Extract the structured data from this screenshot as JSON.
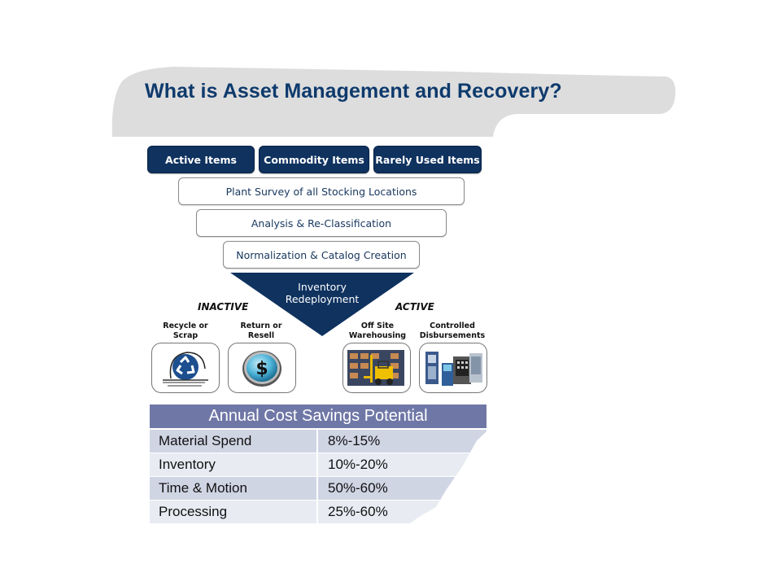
{
  "title": "What is Asset Management and Recovery?",
  "item_categories": [
    "Active Items",
    "Commodity Items",
    "Rarely Used Items"
  ],
  "process_steps": [
    "Plant Survey of all Stocking Locations",
    "Analysis & Re-Classification",
    "Normalization & Catalog Creation"
  ],
  "redeployment": {
    "line1": "Inventory",
    "line2": "Redeployment"
  },
  "inactive": {
    "label": "INACTIVE",
    "options": [
      {
        "line1": "Recycle or",
        "line2": "Scrap",
        "icon": "recycle-icon"
      },
      {
        "line1": "Return or",
        "line2": "Resell",
        "icon": "dollar-coin-icon"
      }
    ]
  },
  "active": {
    "label": "ACTIVE",
    "options": [
      {
        "line1": "Off Site",
        "line2": "Warehousing",
        "icon": "forklift-warehouse-icon"
      },
      {
        "line1": "Controlled",
        "line2": "Disbursements",
        "icon": "vending-machines-icon"
      }
    ]
  },
  "savings_table": {
    "header": "Annual Cost Savings Potential",
    "rows": [
      {
        "category": "Material Spend",
        "range": "8%-15%"
      },
      {
        "category": "Inventory",
        "range": "10%-20%"
      },
      {
        "category": "Time & Motion",
        "range": "50%-60%"
      },
      {
        "category": "Processing",
        "range": "25%-60%"
      }
    ]
  },
  "colors": {
    "navy": "#0f325f",
    "title": "#0e3a6c",
    "banner_gray": "#dcdcdc",
    "table_header": "#6f77a6",
    "row_dark": "#d0d5e4",
    "row_light": "#e8ebf2"
  }
}
